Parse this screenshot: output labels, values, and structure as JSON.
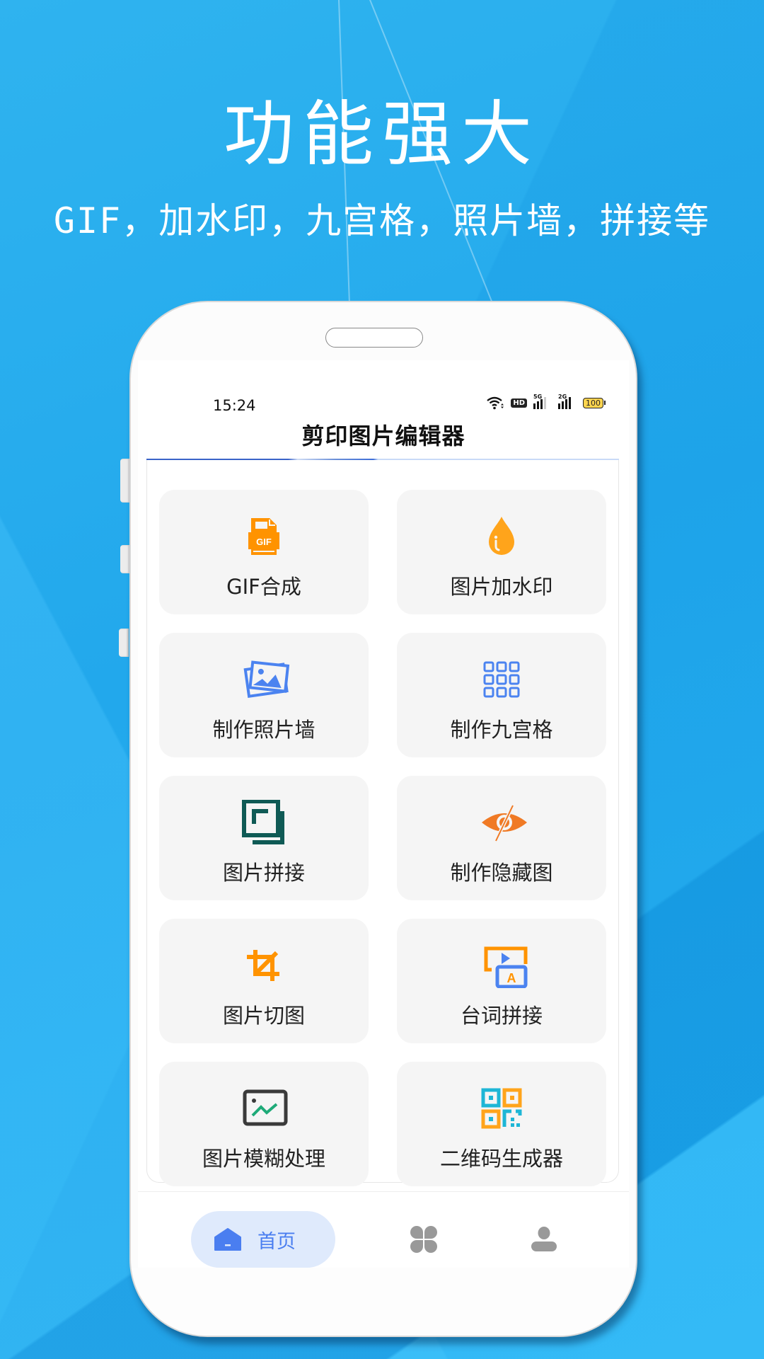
{
  "promo": {
    "headline": "功能强大",
    "subline": "GIF，加水印，九宫格，照片墙，拼接等"
  },
  "status_bar": {
    "time": "15:24",
    "icons": [
      "wifi-icon",
      "hd-icon",
      "signal-5g-icon",
      "signal-2g-icon",
      "battery-icon"
    ],
    "hd_label": "HD",
    "sig1_label": "5G",
    "sig2_label": "2G",
    "battery_level": "100"
  },
  "app": {
    "title": "剪印图片编辑器"
  },
  "features": [
    {
      "label": "GIF合成",
      "icon": "gif-file-icon",
      "color": "#ff9300"
    },
    {
      "label": "图片加水印",
      "icon": "water-drop-icon",
      "color": "#ffa41b"
    },
    {
      "label": "制作照片墙",
      "icon": "photo-stack-icon",
      "color": "#4b83f0"
    },
    {
      "label": "制作九宫格",
      "icon": "nine-grid-icon",
      "color": "#4b83f0"
    },
    {
      "label": "图片拼接",
      "icon": "overlap-squares-icon",
      "color": "#0f5a55"
    },
    {
      "label": "制作隐藏图",
      "icon": "eye-off-icon",
      "color": "#f07a25"
    },
    {
      "label": "图片切图",
      "icon": "crop-icon",
      "color": "#ff9300"
    },
    {
      "label": "台词拼接",
      "icon": "subtitle-play-icon",
      "color": "#ff9300"
    },
    {
      "label": "图片模糊处理",
      "icon": "image-chart-icon",
      "color": "#3a3a3a"
    },
    {
      "label": "二维码生成器",
      "icon": "qr-code-icon",
      "color": "#1eb6d6"
    }
  ],
  "tabbar": {
    "items": [
      {
        "label": "首页",
        "icon": "home-icon",
        "active": true
      },
      {
        "label": "",
        "icon": "apps-clover-icon",
        "active": false
      },
      {
        "label": "",
        "icon": "profile-icon",
        "active": false
      }
    ],
    "active_color": "#4a7ef0",
    "inactive_color": "#999999"
  }
}
